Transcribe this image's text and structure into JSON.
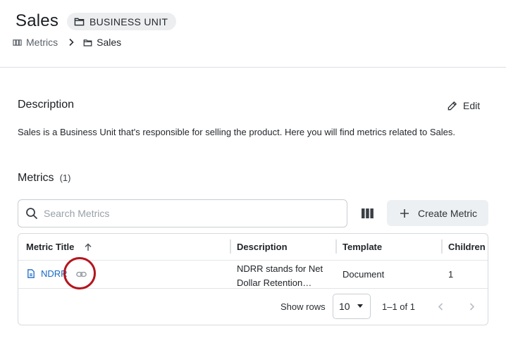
{
  "page": {
    "title": "Sales",
    "badge": "BUSINESS UNIT",
    "breadcrumb": [
      {
        "label": "Metrics",
        "icon": "metrics-icon"
      },
      {
        "label": "Sales",
        "icon": "folder-icon"
      }
    ]
  },
  "description": {
    "heading": "Description",
    "edit_label": "Edit",
    "text": "Sales is a Business Unit that's responsible for selling the product. Here you will find metrics related to Sales."
  },
  "metrics": {
    "heading": "Metrics",
    "count": "(1)",
    "search_placeholder": "Search Metrics",
    "create_label": "Create Metric",
    "columns": [
      "Metric Title",
      "Description",
      "Template",
      "Children"
    ],
    "rows": [
      {
        "title": "NDRR",
        "description_line1": "NDRR stands for Net",
        "description_line2": "Dollar Retention…",
        "template": "Document",
        "children": "1"
      }
    ],
    "pagination": {
      "rows_label": "Show rows",
      "rows_value": "10",
      "range": "1–1 of 1"
    }
  },
  "colors": {
    "link": "#1769c7",
    "highlight_ring": "#b3161e",
    "chip_bg": "#eceef0"
  }
}
